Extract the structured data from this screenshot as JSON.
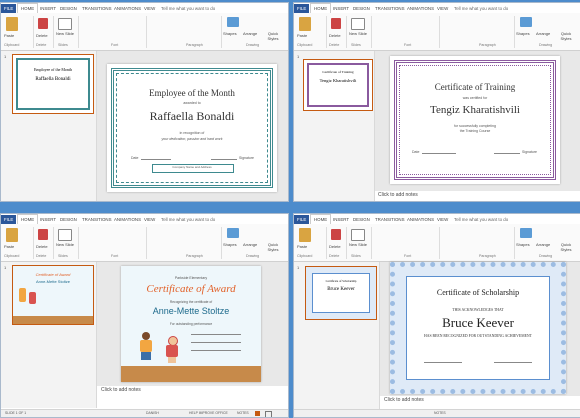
{
  "tabs": [
    "FILE",
    "HOME",
    "INSERT",
    "DESIGN",
    "TRANSITIONS",
    "ANIMATIONS",
    "VIEW"
  ],
  "tell": "Tell me what you want to do",
  "ribbon": {
    "paste": "Paste",
    "delete": "Delete",
    "new_slide": "New Slide",
    "shapes": "Shapes",
    "arrange": "Arrange",
    "quick_styles": "Quick Styles",
    "clipboard": "Clipboard",
    "slides": "Slides",
    "font": "Font",
    "paragraph": "Paragraph",
    "drawing": "Drawing",
    "delete_group": "Delete"
  },
  "slide_number": "1",
  "notes_placeholder": "Click to add notes",
  "status_bar": {
    "slide": "SLIDE 1 OF 1",
    "lang": "DANISH",
    "help": "HELP IMPROVE OFFICE",
    "notes": "NOTES"
  },
  "cert1": {
    "title": "Employee of the Month",
    "presented": "awarded to",
    "name": "Raffaella Bonaldi",
    "line1": "in recognition of",
    "line2": "your dedication, passion and hard work",
    "date_label": "Date",
    "sign_label": "Signature",
    "footer": "Company Name and Address",
    "thumb_title": "Employee of the Month",
    "thumb_name": "Raffaella Bonaldi"
  },
  "cert2": {
    "title": "Certificate of Training",
    "presented": "was certified for",
    "name": "Tengiz Kharatishvili",
    "line1": "for successfully completing",
    "line2": "the Training Course",
    "date_label": "Date",
    "sign_label": "Signature",
    "thumb_title": "Certificate of Training",
    "thumb_name": "Tengiz Kharatishvili"
  },
  "cert3": {
    "school": "Parkside Elementary",
    "title": "Certificate of Award",
    "presented": "Recognizing the certificate of",
    "name": "Anne-Mette Stoltze",
    "line1": "For outstanding performance",
    "thumb_title": "Certificate of Award",
    "thumb_name": "Anne-Mette Stoltze"
  },
  "cert4": {
    "title": "Certificate of Scholarship",
    "ack": "THIS ACKNOWLEDGES THAT",
    "name": "Bruce Keever",
    "line1": "HAS BEEN RECOGNIZED FOR OUTSTANDING ACHIEVEMENT",
    "thumb_title": "Certificate of Scholarship",
    "thumb_name": "Bruce Keever"
  },
  "colors": {
    "background": "#4d8ccc",
    "file_tab": "#2b579a",
    "green_border": "#3e8a8f",
    "purple_border": "#8a5a9e",
    "orange_title": "#e2622a",
    "blue_pattern": "#5b8fcf"
  }
}
